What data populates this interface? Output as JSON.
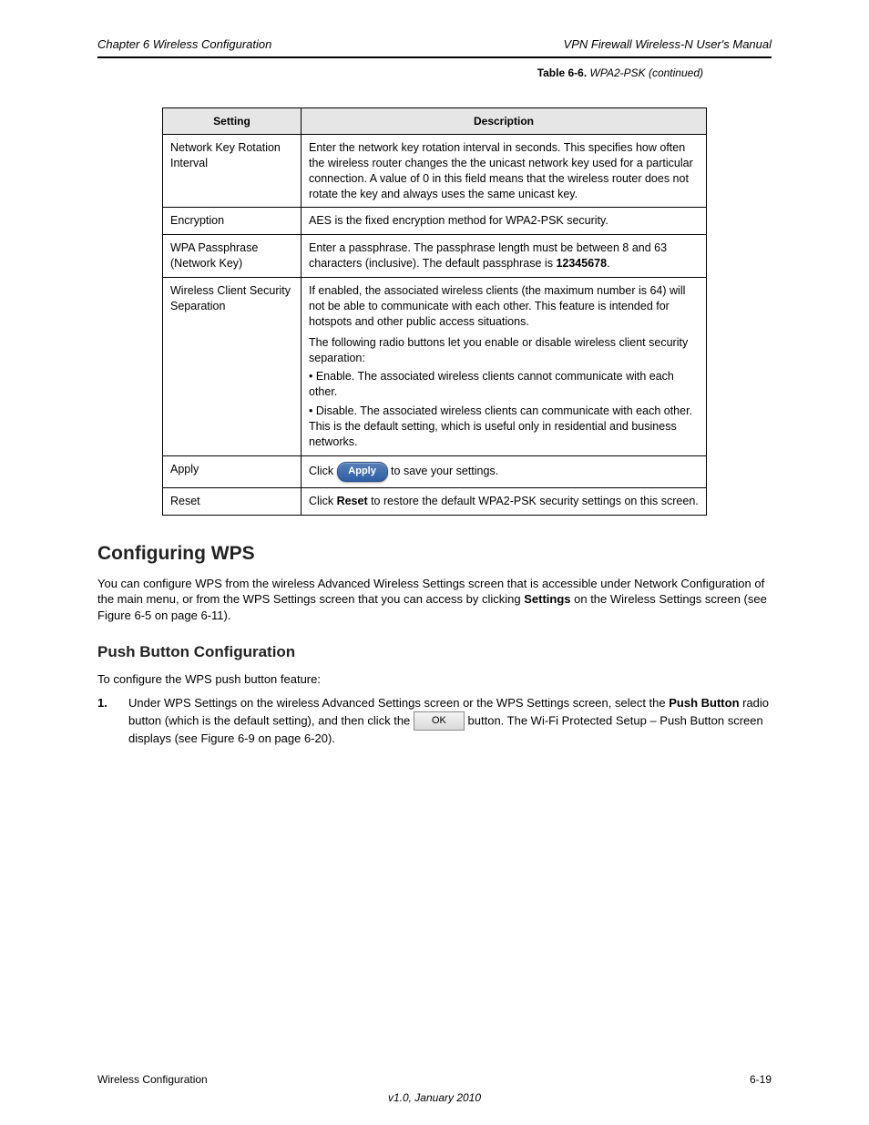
{
  "header": {
    "left": "Chapter 6 Wireless Configuration",
    "right": "VPN Firewall Wireless-N User's Manual"
  },
  "table": {
    "caption_top": {
      "num": "Table 6-6.",
      "title": "WPA2-PSK (continued)"
    },
    "columns": [
      "Setting",
      "Description"
    ],
    "rows": [
      {
        "label": "Network Key Rotation Interval",
        "desc": "Enter the network key rotation interval in seconds. This specifies how often the wireless router changes the the unicast network key used for a particular connection. A value of 0 in this field means that the wireless router does not rotate the key and always uses the same unicast key."
      },
      {
        "label": "Encryption",
        "desc": "AES is the fixed encryption method for WPA2-PSK security."
      },
      {
        "label": "WPA Passphrase (Network Key)",
        "desc_pre": "Enter a passphrase. The passphrase length must be between 8 and 63 characters (inclusive). The default passphrase is ",
        "desc_bold": "12345678",
        "desc_post": "."
      },
      {
        "label": "Wireless Client Security Separation",
        "desc_parts": [
          "If enabled, the associated wireless clients (the maximum number is 64) will not be able to communicate with each other. This feature is intended for hotspots and other public access situations.",
          "The following radio buttons let you enable or disable wireless client security separation:",
          "• Enable. The associated wireless clients cannot communicate with each other.",
          "• Disable. The associated wireless clients can communicate with each other. This is the default setting, which is useful only in residential and business networks."
        ]
      },
      {
        "label": "Apply",
        "desc_pre": "Click ",
        "desc_post": " to save your settings.",
        "is_apply_row": true
      },
      {
        "label": "Reset",
        "desc_pre": "Click ",
        "desc_bold": "Reset",
        "desc_post": " to restore the default WPA2-PSK security settings on this screen."
      }
    ]
  },
  "sections": {
    "h3": "Configuring WPS",
    "para1_pre": "You can configure WPS from the wireless Advanced Wireless Settings screen that is accessible under Network Configuration of the main menu, or from the WPS Settings screen that you can access by clicking ",
    "para1_bold": "Settings",
    "para1_post": " on the Wireless Settings screen (see Figure 6-5 on page 6-11).",
    "h4": "Push Button Configuration",
    "para2": "To configure the WPS push button feature:",
    "step_num": "1.",
    "step_pre": "Under WPS Settings on the wireless Advanced Settings screen or the WPS Settings screen, select the ",
    "step_bold": "Push Button",
    "step_mid": " radio button (which is the default setting), and then click the ",
    "ok_label": "OK",
    "step_post": " button. The Wi-Fi Protected Setup – Push Button screen displays (see Figure 6-9 on page 6-20)."
  },
  "footer": {
    "left": "Wireless Configuration",
    "right": "6-19",
    "version": "v1.0, January 2010"
  }
}
